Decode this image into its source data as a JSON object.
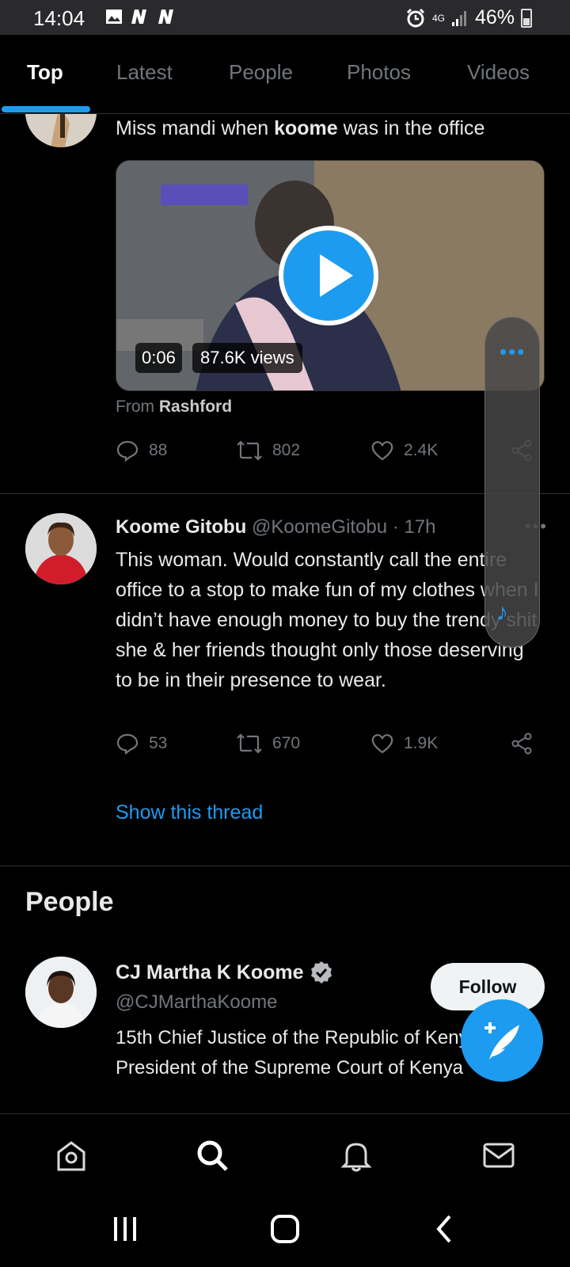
{
  "status_bar": {
    "time": "14:04",
    "battery": "46%",
    "network": "4G"
  },
  "tabs": [
    {
      "label": "Top"
    },
    {
      "label": "Latest"
    },
    {
      "label": "People"
    },
    {
      "label": "Photos"
    },
    {
      "label": "Videos"
    }
  ],
  "tweet1": {
    "text_prefix": "Miss mandi when ",
    "text_bold": "koome",
    "text_suffix": " was in the office",
    "video": {
      "duration": "0:06",
      "views": "87.6K views"
    },
    "from_label": "From",
    "from_name": "Rashford",
    "replies": "88",
    "retweets": "802",
    "likes": "2.4K"
  },
  "tweet2": {
    "name": "Koome Gitobu",
    "handle": "@KoomeGitobu",
    "time": "· 17h",
    "text": "This woman. Would constantly call the entire office to a stop to make fun of my clothes when I didn’t have enough money to buy the trendy shit she & her friends thought only those deserving to be in their presence to wear.",
    "replies": "53",
    "retweets": "670",
    "likes": "1.9K",
    "show_thread": "Show this thread"
  },
  "people_section": {
    "title": "People",
    "name": "CJ Martha K Koome",
    "handle": "@CJMarthaKoome",
    "bio": "15th Chief Justice of the Republic of Kenya | President of the Supreme Court of Kenya",
    "follow_label": "Follow"
  },
  "colors": {
    "accent": "#1d9bf0",
    "muted": "#71767b",
    "background": "#000000"
  }
}
